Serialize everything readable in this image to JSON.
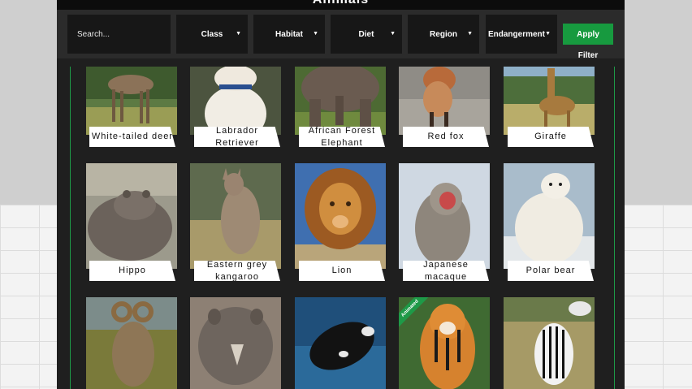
{
  "app": {
    "title": "Animals"
  },
  "filters": {
    "search_placeholder": "Search...",
    "dropdowns": [
      {
        "label": "Class"
      },
      {
        "label": "Habitat"
      },
      {
        "label": "Diet"
      },
      {
        "label": "Region"
      },
      {
        "label": "Endangerment"
      }
    ],
    "apply_label": "Apply Filter",
    "arrow_glyph": "▼"
  },
  "colors": {
    "accent": "#179a3f",
    "panel": "#1f1f1f",
    "filter_bg": "#171717"
  },
  "animals": [
    {
      "name": "White-tailed deer",
      "icon": "deer-photo"
    },
    {
      "name": "Labrador Retriever",
      "icon": "dog-photo"
    },
    {
      "name": "African Forest Elephant",
      "icon": "elephant-photo"
    },
    {
      "name": "Red fox",
      "icon": "fox-photo"
    },
    {
      "name": "Giraffe",
      "icon": "giraffe-photo"
    },
    {
      "name": "Hippo",
      "icon": "hippo-photo"
    },
    {
      "name": "Eastern grey kangaroo",
      "icon": "kangaroo-photo"
    },
    {
      "name": "Lion",
      "icon": "lion-photo"
    },
    {
      "name": "Japanese macaque",
      "icon": "macaque-photo"
    },
    {
      "name": "Polar bear",
      "icon": "polar-bear-photo"
    },
    {
      "name": "",
      "icon": "bighorn-sheep-photo"
    },
    {
      "name": "",
      "icon": "rhino-photo"
    },
    {
      "name": "",
      "icon": "whale-photo"
    },
    {
      "name": "",
      "icon": "tiger-photo",
      "badge": "Animated"
    },
    {
      "name": "",
      "icon": "zebra-photo"
    }
  ]
}
